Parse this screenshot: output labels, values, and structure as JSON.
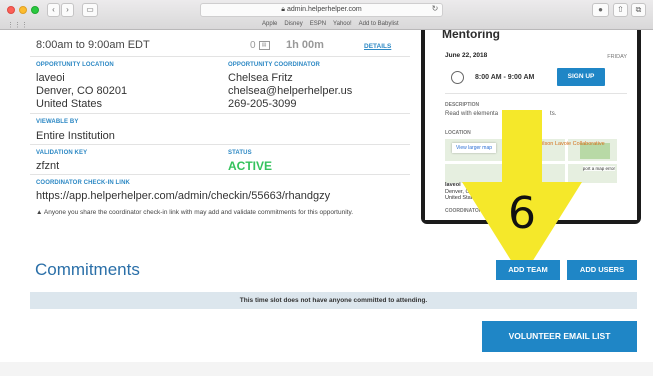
{
  "browser": {
    "url": "admin.helperhelper.com",
    "bookmarks": [
      "Apple",
      "Disney",
      "ESPN",
      "Yahoo!",
      "Add to Babylist"
    ]
  },
  "details": {
    "time_value": "8:00am to 9:00am EDT",
    "count_value": "0",
    "duration": "1h 00m",
    "details_link": "DETAILS",
    "location_label": "OPPORTUNITY LOCATION",
    "location_lines": [
      "laveoi",
      "Denver, CO 80201",
      "United States"
    ],
    "coordinator_label": "OPPORTUNITY COORDINATOR",
    "coordinator_lines": [
      "Chelsea Fritz",
      "chelsea@helperhelper.us",
      "269-205-3099"
    ],
    "viewable_label": "VIEWABLE BY",
    "viewable_value": "Entire Institution",
    "validation_label": "VALIDATION KEY",
    "validation_value": "zfznt",
    "status_label": "STATUS",
    "status_value": "ACTIVE",
    "checkin_label": "COORDINATOR CHECK-IN LINK",
    "checkin_value": "https://app.helperhelper.com/admin/checkin/55663/rhandgzy",
    "warning_text": "Anyone you share the coordinator check-in link with may add and validate commitments for this opportunity."
  },
  "phone": {
    "title": "Mentoring",
    "date": "June 22, 2018",
    "day": "FRIDAY",
    "slot_time": "8:00 AM - 9:00 AM",
    "signup_label": "SIGN UP",
    "description_label": "DESCRIPTION",
    "description_text": "Read with elementa",
    "description_tail": "ts.",
    "location_label": "LOCATION",
    "map_link": "View larger map",
    "map_place": "hilson Lavoie Collaborative",
    "map_report": "port a map error",
    "address_name": "laveoi",
    "address_lines": [
      "Denver, C",
      "United Stat"
    ],
    "coordinator_label": "COORDINATOR"
  },
  "overlay": {
    "number": "6",
    "color": "#f5e82a"
  },
  "commitments": {
    "title": "Commitments",
    "add_team": "ADD TEAM",
    "add_users": "ADD USERS",
    "notice": "This time slot does not have anyone committed to attending.",
    "volunteer_email": "VOLUNTEER EMAIL LIST"
  },
  "colors": {
    "accent": "#1f86c6",
    "label": "#2c88c4",
    "active": "#35c25d"
  }
}
